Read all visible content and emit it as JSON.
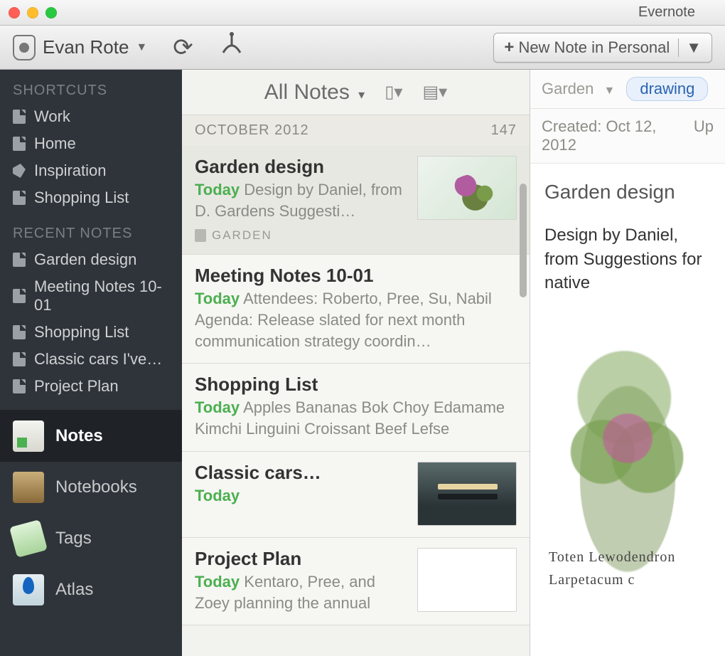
{
  "app": {
    "title": "Evernote"
  },
  "toolbar": {
    "account_name": "Evan Rote",
    "new_note_label": "New Note in Personal"
  },
  "sidebar": {
    "sections": {
      "shortcuts_title": "SHORTCUTS",
      "recent_title": "RECENT NOTES"
    },
    "shortcuts": [
      {
        "label": "Work",
        "icon": "note"
      },
      {
        "label": "Home",
        "icon": "note"
      },
      {
        "label": "Inspiration",
        "icon": "tag"
      },
      {
        "label": "Shopping List",
        "icon": "note"
      }
    ],
    "recent": [
      {
        "label": "Garden design"
      },
      {
        "label": "Meeting Notes 10-01"
      },
      {
        "label": "Shopping List"
      },
      {
        "label": "Classic cars I've…"
      },
      {
        "label": "Project Plan"
      }
    ],
    "nav": [
      {
        "label": "Notes",
        "active": true
      },
      {
        "label": "Notebooks"
      },
      {
        "label": "Tags"
      },
      {
        "label": "Atlas"
      }
    ]
  },
  "list": {
    "header_title": "All Notes",
    "month_header": "OCTOBER 2012",
    "month_count": "147",
    "notes": [
      {
        "title": "Garden design",
        "date": "Today",
        "snippet": "Design by Daniel, from D. Gardens Suggesti…",
        "notebook": "GARDEN",
        "thumb": "garden",
        "selected": true
      },
      {
        "title": "Meeting Notes 10-01",
        "date": "Today",
        "snippet": "Attendees: Roberto, Pree, Su, Nabil Agenda: Release slated for next month communication strategy coordin…"
      },
      {
        "title": "Shopping List",
        "date": "Today",
        "snippet": "Apples Bananas Bok Choy Edamame Kimchi Linguini Croissant Beef Lefse"
      },
      {
        "title": "Classic cars…",
        "date": "Today",
        "snippet": "",
        "thumb": "car"
      },
      {
        "title": "Project Plan",
        "date": "Today",
        "snippet": "Kentaro, Pree, and Zoey planning the annual",
        "thumb": "plan"
      }
    ]
  },
  "detail": {
    "notebook": "Garden",
    "tag": "drawing",
    "created_label": "Created: Oct 12, 2012",
    "updated_label": "Up",
    "title": "Garden design",
    "body": "Design by Daniel, from Suggestions for native",
    "sketch_labels": "Toten\nLewodendron\nLarpetacum c\n"
  }
}
